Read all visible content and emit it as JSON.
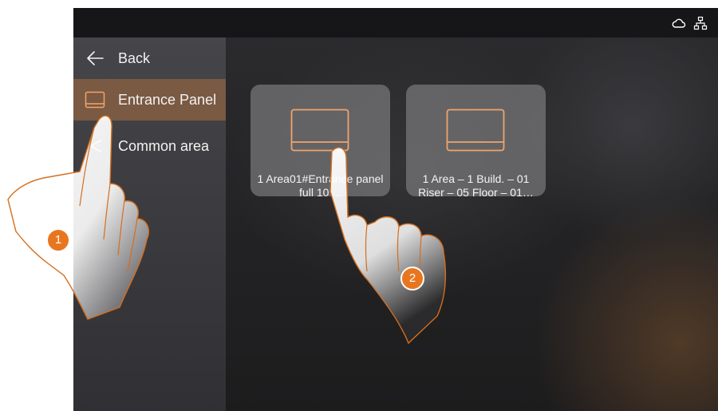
{
  "status_bar": {
    "icons": [
      "cloud-icon",
      "network-icon"
    ]
  },
  "sidebar": {
    "back_label": "Back",
    "items": [
      {
        "label": "Entrance Panel",
        "icon": "panel-icon",
        "active": true
      },
      {
        "label": "Common area",
        "icon": "area-icon",
        "active": false
      }
    ]
  },
  "devices": [
    {
      "label": "1 Area01#Entrance panel full 10 ..."
    },
    {
      "label": "1 Area – 1 Build. – 01 Riser – 05 Floor – 01…"
    }
  ],
  "steps": {
    "step1": "1",
    "step2": "2"
  },
  "colors": {
    "accent": "#e8761f",
    "active_row": "#7a5a43",
    "icon_stroke": "#f0a46a"
  }
}
